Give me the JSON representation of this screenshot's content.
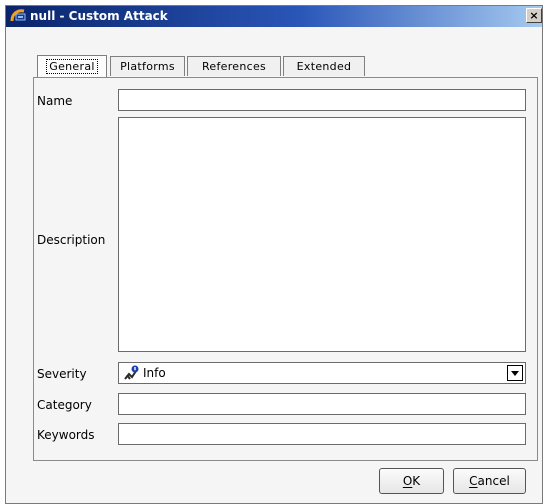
{
  "window": {
    "title": "null - Custom Attack",
    "close_glyph": "×"
  },
  "tabs": [
    {
      "label": "General",
      "active": true
    },
    {
      "label": "Platforms",
      "active": false
    },
    {
      "label": "References",
      "active": false
    },
    {
      "label": "Extended",
      "active": false
    }
  ],
  "form": {
    "name_label": "Name",
    "name_value": "",
    "description_label": "Description",
    "description_value": "",
    "severity_label": "Severity",
    "severity_value": "Info",
    "severity_icon": "info-severity-icon",
    "category_label": "Category",
    "category_value": "",
    "keywords_label": "Keywords",
    "keywords_value": ""
  },
  "buttons": {
    "ok_mnemonic": "O",
    "ok_rest": "K",
    "cancel_mnemonic": "C",
    "cancel_rest": "ancel"
  },
  "colors": {
    "titlebar_start": "#0a246a",
    "titlebar_end": "#a6caf0"
  }
}
